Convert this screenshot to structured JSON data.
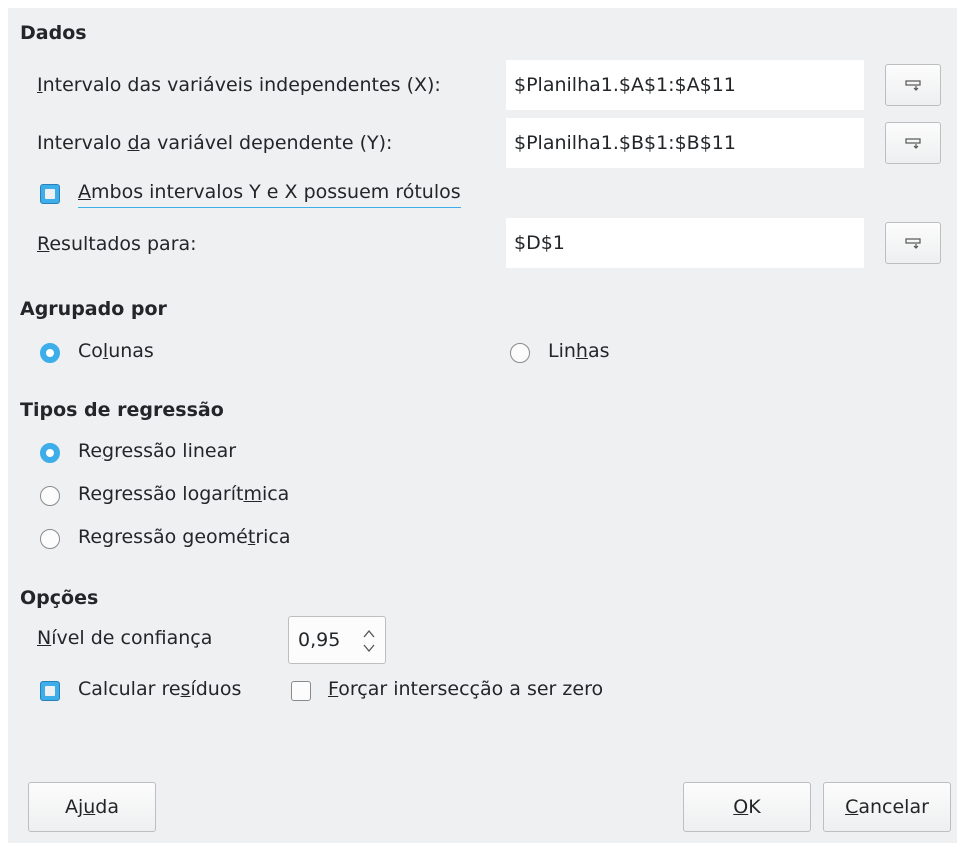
{
  "sections": {
    "dados": "Dados",
    "agrupado": "Agrupado por",
    "tipos": "Tipos de regressão",
    "opcoes": "Opções"
  },
  "dados": {
    "x_label_pre": "",
    "x_label_u": "I",
    "x_label_post": "ntervalo das variáveis independentes (X):",
    "x_value": "$Planilha1.$A$1:$A$11",
    "y_label_pre": "Intervalo ",
    "y_label_u": "d",
    "y_label_post": "a variável dependente (Y):",
    "y_value": "$Planilha1.$B$1:$B$11",
    "labels_checkbox_u": "A",
    "labels_checkbox_post": "mbos intervalos Y e X possuem rótulos",
    "labels_checked": true,
    "results_u": "R",
    "results_post": "esultados para:",
    "results_value": "$D$1"
  },
  "agrupado": {
    "colunas_pre": "Co",
    "colunas_u": "l",
    "colunas_post": "unas",
    "linhas_pre": "Lin",
    "linhas_u": "h",
    "linhas_post": "as",
    "selected": "colunas"
  },
  "tipos": {
    "linear_pre": "Re",
    "linear_u": "g",
    "linear_post": "ressão linear",
    "log_pre": "Regressão logarít",
    "log_u": "m",
    "log_post": "ica",
    "geo_pre": "Regressão geomé",
    "geo_u": "t",
    "geo_post": "rica",
    "selected": "linear"
  },
  "opcoes": {
    "confianca_u": "N",
    "confianca_post": "ível de confiança",
    "confianca_value": "0,95",
    "residuos_pre": "Calcular re",
    "residuos_u": "s",
    "residuos_post": "íduos",
    "residuos_checked": true,
    "zero_u": "F",
    "zero_post": "orçar intersecção a ser zero",
    "zero_checked": false
  },
  "buttons": {
    "help_pre": "Aj",
    "help_u": "u",
    "help_post": "da",
    "ok_u": "O",
    "ok_post": "K",
    "cancel_u": "C",
    "cancel_post": "ancelar"
  },
  "icons": {
    "shrink": "shrink-icon",
    "spin": "spin-arrows-icon"
  },
  "colors": {
    "accent": "#3daee9",
    "background": "#eff0f1"
  }
}
